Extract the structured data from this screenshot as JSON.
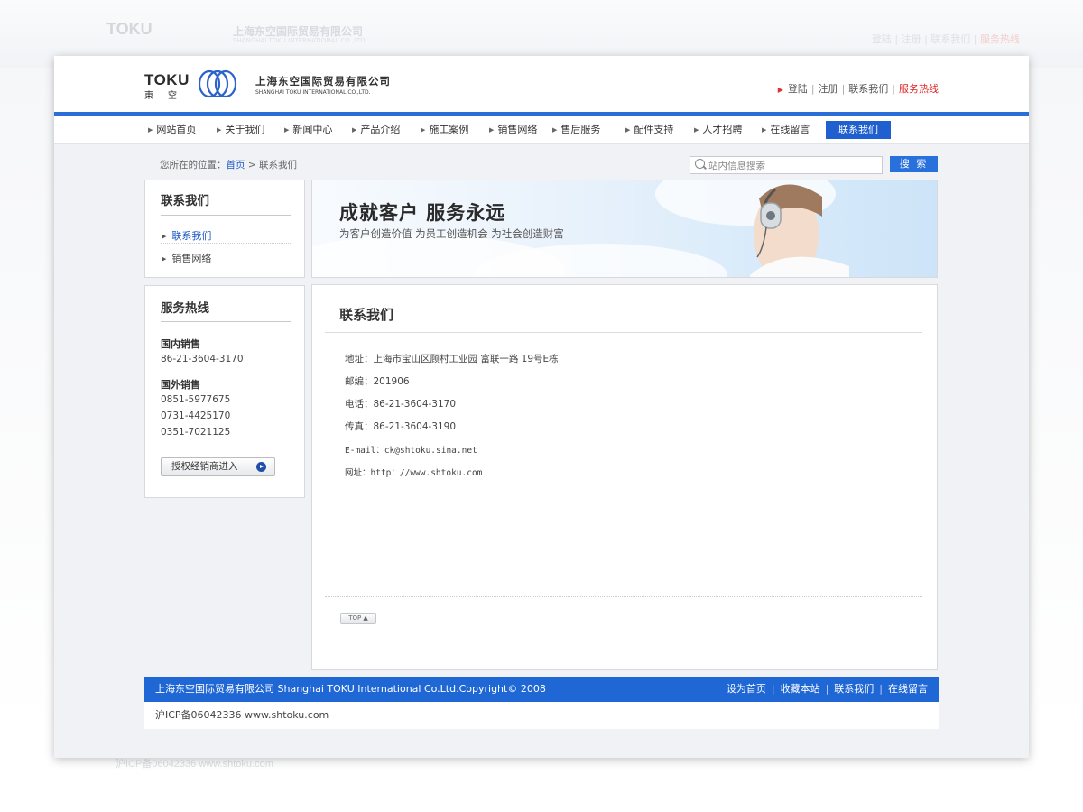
{
  "brand": {
    "logo_text": "TOKU",
    "logo_kanji": "東空",
    "company_cn": "上海东空国际贸易有限公司",
    "company_en": "SHANGHAI TOKU INTERNATIONAL CO.,LTD."
  },
  "top_links": {
    "login": "登陆",
    "register": "注册",
    "contact": "联系我们",
    "hotline": "服务热线"
  },
  "nav": [
    {
      "label": "网站首页"
    },
    {
      "label": "关于我们"
    },
    {
      "label": "新闻中心"
    },
    {
      "label": "产品介绍"
    },
    {
      "label": "施工案例"
    },
    {
      "label": "销售网络"
    },
    {
      "label": "售后服务"
    },
    {
      "label": "配件支持"
    },
    {
      "label": "人才招聘"
    },
    {
      "label": "在线留言"
    },
    {
      "label": "联系我们",
      "active": true
    }
  ],
  "breadcrumb": {
    "prefix": "您所在的位置：",
    "home": "首页",
    "sep": ">",
    "current": "联系我们"
  },
  "search": {
    "placeholder": "站内信息搜索",
    "button": "搜 索"
  },
  "sidebar_menu": {
    "title": "联系我们",
    "items": [
      {
        "label": "联系我们"
      },
      {
        "label": "销售网络"
      }
    ]
  },
  "hotline": {
    "title": "服务热线",
    "domestic_label": "国内销售",
    "domestic_numbers": [
      "86-21-3604-3170"
    ],
    "foreign_label": "国外销售",
    "foreign_numbers": [
      "0851-5977675",
      "0731-4425170",
      "0351-7021125"
    ],
    "agent_button": "授权经销商进入"
  },
  "banner": {
    "title": "成就客户  服务永远",
    "subtitle": "为客户创造价值 为员工创造机会 为社会创造财富"
  },
  "content": {
    "title": "联系我们",
    "address": "地址：上海市宝山区顾村工业园 富联一路 19号E栋",
    "zip": "邮编：201906",
    "phone": "电话：86-21-3604-3170",
    "fax": "传真：86-21-3604-3190",
    "email": "E-mail：ck@shtoku.sina.net",
    "website": "网址：http：//www.shtoku.com",
    "top_button": "TOP ▲"
  },
  "footer": {
    "copyright": "上海东空国际贸易有限公司  Shanghai TOKU International Co.Ltd.Copyright© 2008",
    "links": [
      "设为首页",
      "收藏本站",
      "联系我们",
      "在线留言"
    ],
    "icp": "沪ICP备06042336  www.shtoku.com"
  },
  "colors": {
    "accent": "#2067d6",
    "hotline": "#d22222",
    "link": "#1d58c4"
  }
}
